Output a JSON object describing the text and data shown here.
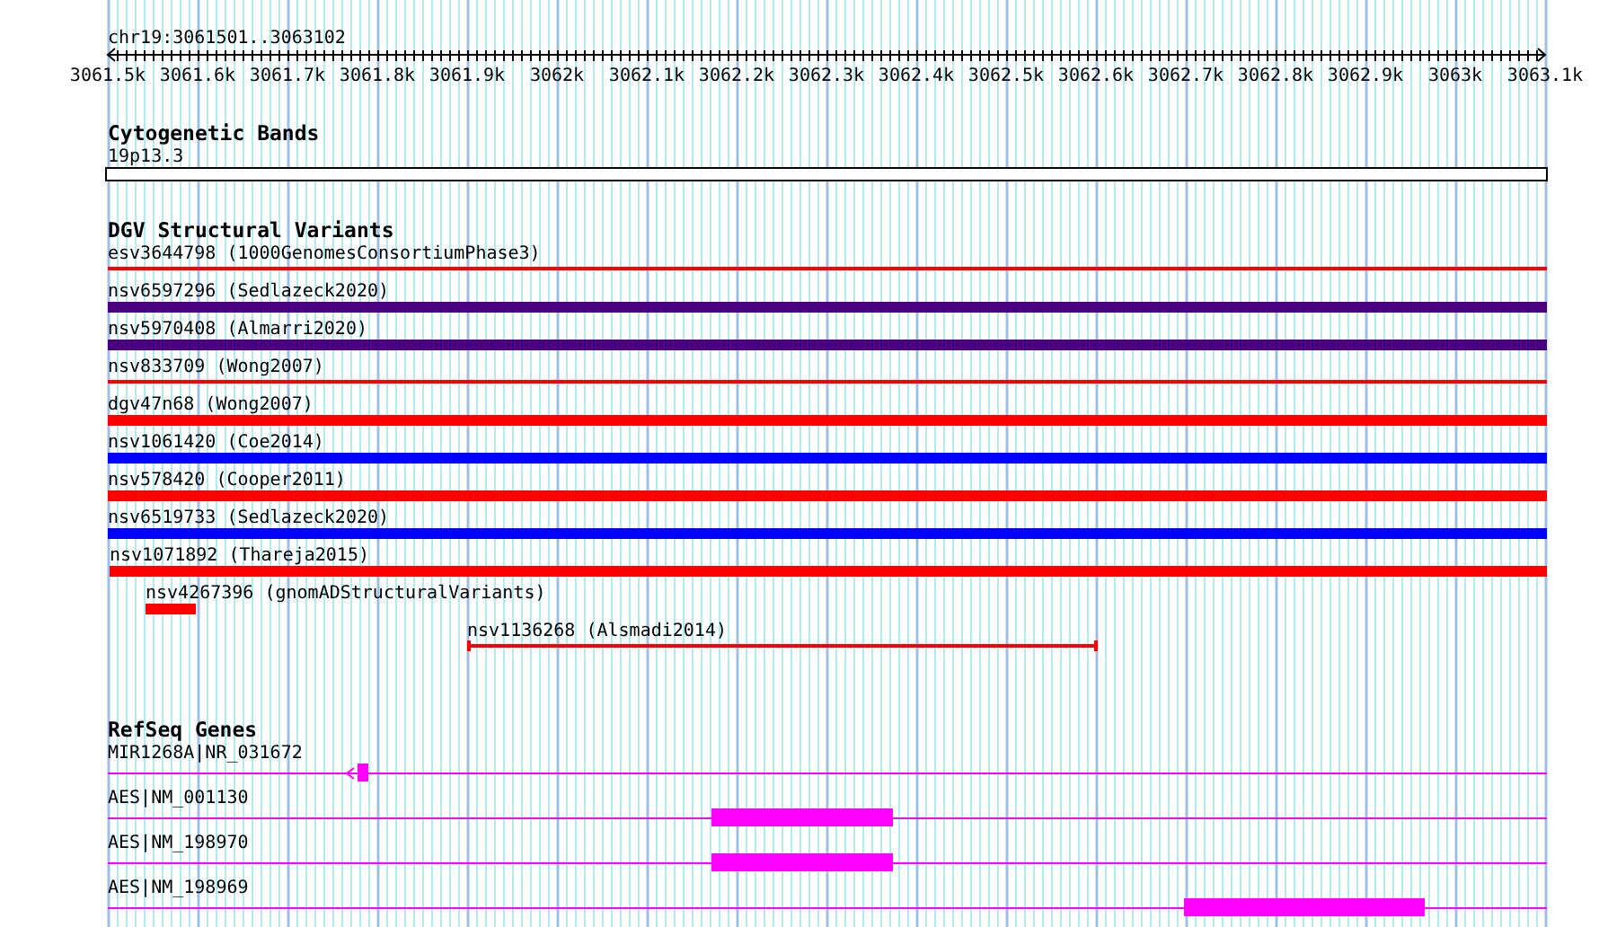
{
  "ruler": {
    "position": "chr19:3061501..3063102",
    "labels": [
      "3061.5k",
      "3061.6k",
      "3061.7k",
      "3061.8k",
      "3061.9k",
      "3062k",
      "3062.1k",
      "3062.2k",
      "3062.3k",
      "3062.4k",
      "3062.5k",
      "3062.6k",
      "3062.7k",
      "3062.8k",
      "3062.9k",
      "3063k",
      "3063.1k"
    ]
  },
  "cytoband_track": {
    "title": "Cytogenetic Bands",
    "band": "19p13.3"
  },
  "variant_track": {
    "title": "DGV Structural Variants",
    "features": [
      {
        "label": "esv3644798 (1000GenomesConsortiumPhase3)",
        "kind": "line",
        "color": "#ff0000"
      },
      {
        "label": "nsv6597296 (Sedlazeck2020)",
        "kind": "bar",
        "color": "#4b0082"
      },
      {
        "label": "nsv5970408 (Almarri2020)",
        "kind": "bar",
        "color": "#4b0082"
      },
      {
        "label": "nsv833709 (Wong2007)",
        "kind": "line",
        "color": "#ff0000"
      },
      {
        "label": "dgv47n68 (Wong2007)",
        "kind": "bar",
        "color": "#ff0000"
      },
      {
        "label": "nsv1061420 (Coe2014)",
        "kind": "bar",
        "color": "#0000ff"
      },
      {
        "label": "nsv578420 (Cooper2011)",
        "kind": "bar",
        "color": "#ff0000"
      },
      {
        "label": "nsv6519733 (Sedlazeck2020)",
        "kind": "bar",
        "color": "#0000ff"
      },
      {
        "label": "nsv1071892 (Thareja2015)",
        "kind": "bar",
        "color": "#ff0000"
      },
      {
        "label": "nsv4267396 (gnomADStructuralVariants)",
        "kind": "bar",
        "color": "#ff0000"
      },
      {
        "label": "nsv1136268 (Alsmadi2014)",
        "kind": "line",
        "color": "#ff0000"
      }
    ]
  },
  "gene_track": {
    "title": "RefSeq Genes",
    "genes": [
      {
        "label": "MIR1268A|NR_031672"
      },
      {
        "label": "AES|NM_001130"
      },
      {
        "label": "AES|NM_198970"
      },
      {
        "label": "AES|NM_198969"
      }
    ]
  }
}
